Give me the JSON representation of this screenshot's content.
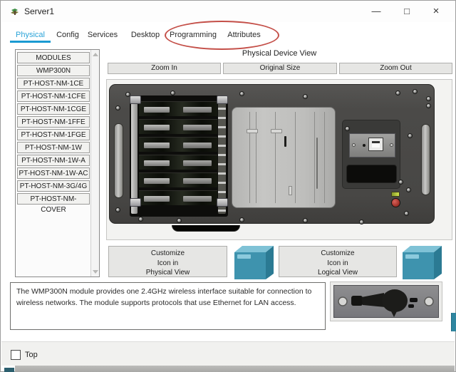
{
  "window": {
    "title": "Server1",
    "minimize_glyph": "—",
    "maximize_glyph": "□",
    "close_glyph": "×"
  },
  "tabs": [
    {
      "label": "Physical",
      "active": true
    },
    {
      "label": "Config",
      "active": false
    },
    {
      "label": "Services",
      "active": false
    },
    {
      "label": "Desktop",
      "active": false
    },
    {
      "label": "Programming",
      "active": false
    },
    {
      "label": "Attributes",
      "active": false
    }
  ],
  "annotation": {
    "shape": "ellipse",
    "color": "#bf4038",
    "circled_tabs": [
      "Programming",
      "Attributes"
    ]
  },
  "sidebar": {
    "header": "MODULES",
    "items": [
      "WMP300N",
      "PT-HOST-NM-1CE",
      "PT-HOST-NM-1CFE",
      "PT-HOST-NM-1CGE",
      "PT-HOST-NM-1FFE",
      "PT-HOST-NM-1FGE",
      "PT-HOST-NM-1W",
      "PT-HOST-NM-1W-A",
      "PT-HOST-NM-1W-AC",
      "PT-HOST-NM-3G/4G",
      "PT-HOST-NM-COVER"
    ]
  },
  "device_view": {
    "title": "Physical Device View",
    "zoom_in": "Zoom In",
    "original_size": "Original Size",
    "zoom_out": "Zoom Out"
  },
  "customize": {
    "physical_label": "Customize\nIcon in\nPhysical View",
    "logical_label": "Customize\nIcon in\nLogical View"
  },
  "description": {
    "text": "The WMP300N module provides one 2.4GHz wireless interface suitable for connection to wireless networks. The module supports protocols that use Ethernet for LAN access."
  },
  "footer": {
    "top_label": "Top",
    "top_checked": false
  },
  "colors": {
    "active_tab": "#2aa3d8",
    "annotation_red": "#bf4038",
    "teal_icon": "#3e93ae",
    "chassis_gray": "#4b4a48",
    "power_red": "#9c2c24",
    "led_green": "#cfe24e"
  }
}
